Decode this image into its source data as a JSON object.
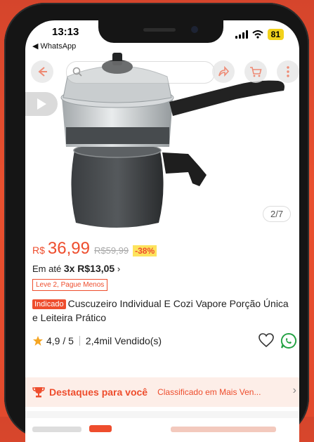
{
  "status_bar": {
    "time": "13:13",
    "back_app": "◀ WhatsApp",
    "battery": "81"
  },
  "gallery": {
    "position": "2/7"
  },
  "product": {
    "currency": "R$",
    "price": "36,99",
    "old_price": "R$59,99",
    "discount": "-38%",
    "installment_prefix": "Em até",
    "installment": "3x R$13,05",
    "installment_arrow": "›",
    "promo_tag": "Leve 2, Pague Menos",
    "badge": "Indicado",
    "title": "Cuscuzeiro Individual E Cozi Vapore Porção Única e Leiteira Prático",
    "rating": "4,9 / 5",
    "sold": "2,4mil Vendido(s)"
  },
  "highlights": {
    "title": "Destaques para você",
    "detail": "Classificado em Mais Ven...",
    "arrow": "›"
  },
  "colors": {
    "accent": "#ee4d2d",
    "discount_bg": "#fde35d",
    "whatsapp": "#25a244",
    "star": "#f5a623"
  }
}
